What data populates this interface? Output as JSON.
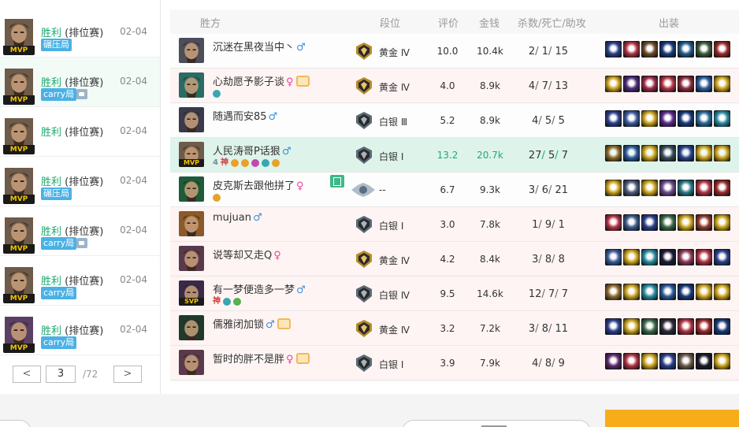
{
  "match_list": {
    "items": [
      {
        "result": "胜利",
        "mode": "(排位赛)",
        "date": "02-04",
        "badge": "MVP",
        "tag": "碾压局",
        "has_pic": false,
        "face": "#6e5b4a",
        "selected": false
      },
      {
        "result": "胜利",
        "mode": "(排位赛)",
        "date": "02-04",
        "badge": "MVP",
        "tag": "carry局",
        "has_pic": true,
        "face": "#6e5b4a",
        "selected": true
      },
      {
        "result": "胜利",
        "mode": "(排位赛)",
        "date": "02-04",
        "badge": "MVP",
        "tag": "",
        "has_pic": false,
        "face": "#6e5b4a",
        "selected": false
      },
      {
        "result": "胜利",
        "mode": "(排位赛)",
        "date": "02-04",
        "badge": "MVP",
        "tag": "碾压局",
        "has_pic": false,
        "face": "#6e5b4a",
        "selected": false
      },
      {
        "result": "胜利",
        "mode": "(排位赛)",
        "date": "02-04",
        "badge": "MVP",
        "tag": "carry局",
        "has_pic": true,
        "face": "#6e5b4a",
        "selected": false
      },
      {
        "result": "胜利",
        "mode": "(排位赛)",
        "date": "02-04",
        "badge": "MVP",
        "tag": "carry局",
        "has_pic": false,
        "face": "#6e5b4a",
        "selected": false
      },
      {
        "result": "胜利",
        "mode": "(排位赛)",
        "date": "02-04",
        "badge": "MVP",
        "tag": "carry局",
        "has_pic": false,
        "face": "#5a3f63",
        "selected": false
      }
    ],
    "pager": {
      "prev": "<",
      "current": "3",
      "total": "/72",
      "next": ">"
    }
  },
  "team": {
    "headers": {
      "side": "胜方",
      "rank": "段位",
      "score": "评价",
      "gold": "金钱",
      "kda": "杀数/死亡/助攻",
      "items": "出装"
    },
    "rows": [
      {
        "name": "沉迷在黑夜当中丶",
        "sex": "♂",
        "honor": false,
        "tags": [],
        "copy": false,
        "rank_tier": "gold",
        "rank": "黄金 Ⅳ",
        "score": "10.0",
        "gold": "10.4k",
        "k": "2",
        "d": "1",
        "a": "15",
        "badge": "",
        "champ": "#4c4f5a",
        "items": [
          "#2a3f8a",
          "#b03344",
          "#6b4a2a",
          "#183a7a",
          "#245a8a",
          "#3a5a3a",
          "#9a2a2a"
        ],
        "style": ""
      },
      {
        "name": "心劫愿予影子谈",
        "sex": "♀",
        "honor": true,
        "tags": [
          {
            "t": "dot",
            "c": "#3aa7b0"
          }
        ],
        "copy": false,
        "rank_tier": "gold",
        "rank": "黄金 Ⅳ",
        "score": "4.0",
        "gold": "8.9k",
        "k": "4",
        "d": "7",
        "a": "13",
        "badge": "",
        "champ": "#2a6b66",
        "items": [
          "#c9a21c",
          "#4a2a7a",
          "#9a2a4a",
          "#b03344",
          "#8a2a3a",
          "#2a5a9a",
          "#c9a21c"
        ],
        "style": "alt"
      },
      {
        "name": "随遇而安85",
        "sex": "♂",
        "honor": false,
        "tags": [],
        "copy": false,
        "rank_tier": "silver",
        "rank": "白银 Ⅲ",
        "score": "5.2",
        "gold": "8.9k",
        "k": "4",
        "d": "5",
        "a": "5",
        "badge": "",
        "champ": "#3a3a4a",
        "items": [
          "#2a3f8a",
          "#3a5a9a",
          "#c9a21c",
          "#5a2a8a",
          "#183a7a",
          "#2a6a9a",
          "#2a8aa0"
        ],
        "style": ""
      },
      {
        "name": "人民涛哥P话狠",
        "sex": "♂",
        "honor": false,
        "tags": [
          {
            "t": "txt",
            "v": "4",
            "c": "#7a8a99"
          },
          {
            "t": "txt",
            "v": "神",
            "c": "#d23a3a"
          },
          {
            "t": "dot",
            "c": "#e9a12a"
          },
          {
            "t": "dot",
            "c": "#e9a12a"
          },
          {
            "t": "dot",
            "c": "#c04ab0"
          },
          {
            "t": "dot",
            "c": "#3aa7b0"
          },
          {
            "t": "dot",
            "c": "#e9a12a"
          }
        ],
        "copy": false,
        "rank_tier": "silver",
        "rank": "白银 Ⅰ",
        "score": "13.2",
        "gold": "20.7k",
        "k": "27",
        "d": "5",
        "a": "7",
        "badge": "MVP",
        "champ": "#6e5b4a",
        "items": [
          "#8a6a2a",
          "#2a5a9a",
          "#c9a21c",
          "#3a4a5a",
          "#2a3f8a",
          "#c9a21c",
          "#c9a21c"
        ],
        "style": "hl"
      },
      {
        "name": "皮克斯去跟他拼了",
        "sex": "♀",
        "honor": false,
        "tags": [
          {
            "t": "dot",
            "c": "#e9a12a"
          }
        ],
        "copy": true,
        "rank_tier": "none",
        "rank": "--",
        "score": "6.7",
        "gold": "9.3k",
        "k": "3",
        "d": "6",
        "a": "21",
        "badge": "",
        "champ": "#1f5a3a",
        "items": [
          "#c9a21c",
          "#4a5a7a",
          "#c9a21c",
          "#6a4a8a",
          "#2a7a8a",
          "#b03344",
          "#9a2a2a"
        ],
        "style": ""
      },
      {
        "name": "mujuan",
        "sex": "♂",
        "honor": false,
        "tags": [],
        "copy": false,
        "rank_tier": "silver",
        "rank": "白银 Ⅰ",
        "score": "3.0",
        "gold": "7.8k",
        "k": "1",
        "d": "9",
        "a": "1",
        "badge": "",
        "champ": "#8a5a2a",
        "items": [
          "#b03344",
          "#3a5a8a",
          "#2a3f8a",
          "#3a6a4a",
          "#c9a21c",
          "#8a3a2a",
          "#c9a21c"
        ],
        "style": "alt"
      },
      {
        "name": "说等却又走Q",
        "sex": "♀",
        "honor": false,
        "tags": [],
        "copy": false,
        "rank_tier": "gold",
        "rank": "黄金 Ⅳ",
        "score": "4.2",
        "gold": "8.4k",
        "k": "3",
        "d": "8",
        "a": "8",
        "badge": "",
        "champ": "#5a3a4a",
        "items": [
          "#3a5a9a",
          "#c9a21c",
          "#2a8aa0",
          "#1a1a3a",
          "#8a3a5a",
          "#b03344",
          "#2a3f8a"
        ],
        "style": "alt"
      },
      {
        "name": "有一梦便造多一梦",
        "sex": "♂",
        "honor": false,
        "tags": [
          {
            "t": "txt",
            "v": "神",
            "c": "#d23a3a"
          },
          {
            "t": "dot",
            "c": "#3aa7b0"
          },
          {
            "t": "dot",
            "c": "#5ab04a"
          }
        ],
        "copy": false,
        "rank_tier": "silver",
        "rank": "白银 Ⅳ",
        "score": "9.5",
        "gold": "14.6k",
        "k": "12",
        "d": "7",
        "a": "7",
        "badge": "SVP",
        "champ": "#3a2a4a",
        "items": [
          "#8a6a2a",
          "#c9a21c",
          "#2a8aa0",
          "#2a5a9a",
          "#183a7a",
          "#c9a21c",
          "#c9a21c"
        ],
        "style": "alt"
      },
      {
        "name": "儒雅闭加锁",
        "sex": "♂",
        "honor": true,
        "tags": [],
        "copy": false,
        "rank_tier": "gold",
        "rank": "黄金 Ⅳ",
        "score": "3.2",
        "gold": "7.2k",
        "k": "3",
        "d": "8",
        "a": "11",
        "badge": "",
        "champ": "#1f3a2a",
        "items": [
          "#2a3f8a",
          "#c9a21c",
          "#3a6a4a",
          "#2a2a3a",
          "#b03344",
          "#9a2a2a",
          "#183a7a"
        ],
        "style": "alt"
      },
      {
        "name": "暂时的胖不是胖",
        "sex": "♀",
        "honor": true,
        "tags": [],
        "copy": false,
        "rank_tier": "silver",
        "rank": "白银 Ⅰ",
        "score": "3.9",
        "gold": "7.9k",
        "k": "4",
        "d": "8",
        "a": "9",
        "badge": "",
        "champ": "#5a3a4a",
        "items": [
          "#5a2a6a",
          "#b03344",
          "#c9a21c",
          "#2a3f8a",
          "#6a5a4a",
          "#1a1a2a",
          "#c9a21c"
        ],
        "style": "alt"
      }
    ]
  },
  "colors": {
    "win": "#1fa971",
    "accent_orange": "#f7ad1a",
    "male": "#3b8ede",
    "female": "#e6459c",
    "gold_rank": "#b88a2a",
    "silver_rank": "#5a6a74"
  }
}
